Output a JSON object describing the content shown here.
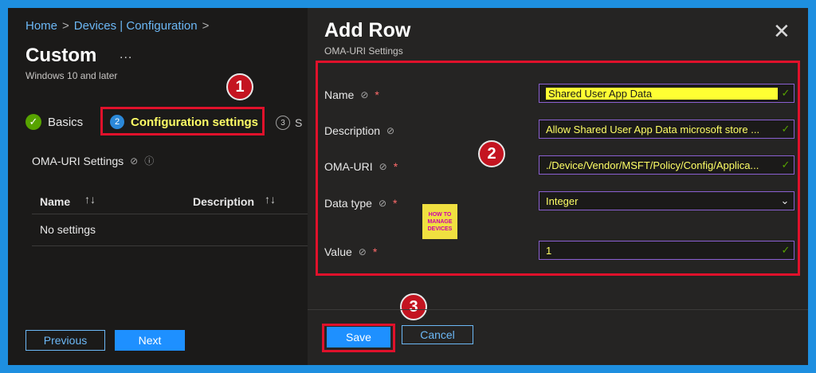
{
  "breadcrumb": {
    "home": "Home",
    "section": "Devices | Configuration",
    "sep": ">"
  },
  "profile": {
    "title": "Custom",
    "more": "...",
    "subtitle": "Windows 10 and later"
  },
  "steps": [
    {
      "label": "Basics",
      "state": "complete",
      "icon": "checkmark-icon"
    },
    {
      "label": "Configuration settings",
      "state": "active",
      "number": "2"
    },
    {
      "label": "S",
      "state": "pending",
      "number": "3"
    }
  ],
  "oma_section": {
    "label": "OMA-URI Settings"
  },
  "table": {
    "columns": [
      "Name",
      "Description"
    ],
    "sort_glyph": "↑↓",
    "empty_text": "No settings"
  },
  "footer_left": {
    "previous": "Previous",
    "next": "Next"
  },
  "add_row": {
    "title": "Add Row",
    "subtitle": "OMA-URI Settings",
    "close": "✕",
    "fields": [
      {
        "label": "Name",
        "value": "Shared User App Data",
        "kind": "text"
      },
      {
        "label": "Description",
        "value": "Allow Shared User App Data microsoft store ...",
        "kind": "text"
      },
      {
        "label": "OMA-URI",
        "value": "./Device/Vendor/MSFT/Policy/Config/Applica...",
        "kind": "text"
      },
      {
        "label": "Data type",
        "value": "Integer",
        "kind": "select"
      },
      {
        "label": "Value",
        "value": "1",
        "kind": "text"
      }
    ],
    "required_mark": "*",
    "save": "Save",
    "cancel": "Cancel"
  },
  "annotations": [
    "1",
    "2",
    "3"
  ],
  "watermark": {
    "line1": "HOW TO",
    "line2": "MANAGE",
    "line3": "DEVICES"
  },
  "colors": {
    "accent": "#1e90ff",
    "highlight_box": "#e0112b",
    "field_text": "#ffff66",
    "success": "#57a300"
  }
}
